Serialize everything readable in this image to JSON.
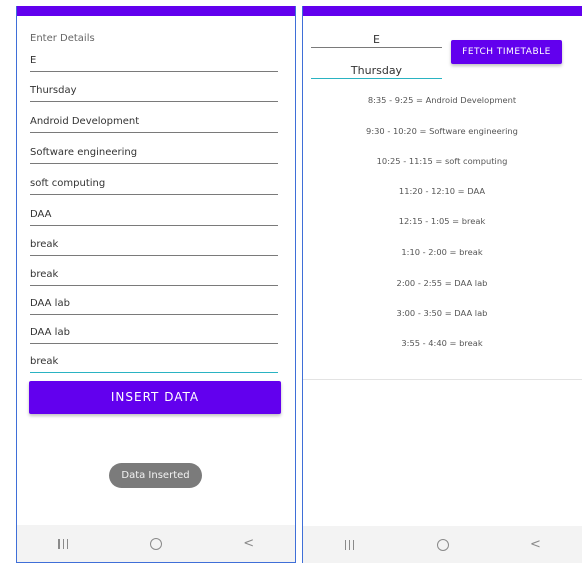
{
  "left_screen": {
    "section_label": "Enter Details",
    "fields": [
      {
        "value": "E"
      },
      {
        "value": "Thursday"
      },
      {
        "value": "Android Development"
      },
      {
        "value": "Software engineering"
      },
      {
        "value": "soft computing"
      },
      {
        "value": "DAA"
      },
      {
        "value": "break"
      },
      {
        "value": "break"
      },
      {
        "value": "DAA lab"
      },
      {
        "value": "DAA lab"
      },
      {
        "value": "break"
      }
    ],
    "insert_button_label": "INSERT DATA",
    "toast_text": "Data Inserted"
  },
  "right_screen": {
    "id_value": "E",
    "day_value": "Thursday",
    "fetch_button_label": "FETCH TIMETABLE",
    "timetable": [
      "8:35 - 9:25 = Android Development",
      "9:30 - 10:20 = Software engineering",
      "10:25 - 11:15 = soft computing",
      "11:20 - 12:10 = DAA",
      "12:15 - 1:05 = break",
      "1:10 - 2:00 = break",
      "2:00 - 2:55 = DAA lab",
      "3:00 - 3:50 = DAA lab",
      "3:55 - 4:40 = break"
    ]
  },
  "navbar": {
    "recents_icon": "recents-icon",
    "home_icon": "home-icon",
    "back_icon": "back-icon",
    "back_glyph": "<"
  },
  "colors": {
    "primary": "#6200ee",
    "accent": "#2ab3c2",
    "frame": "#3f6fd8"
  }
}
